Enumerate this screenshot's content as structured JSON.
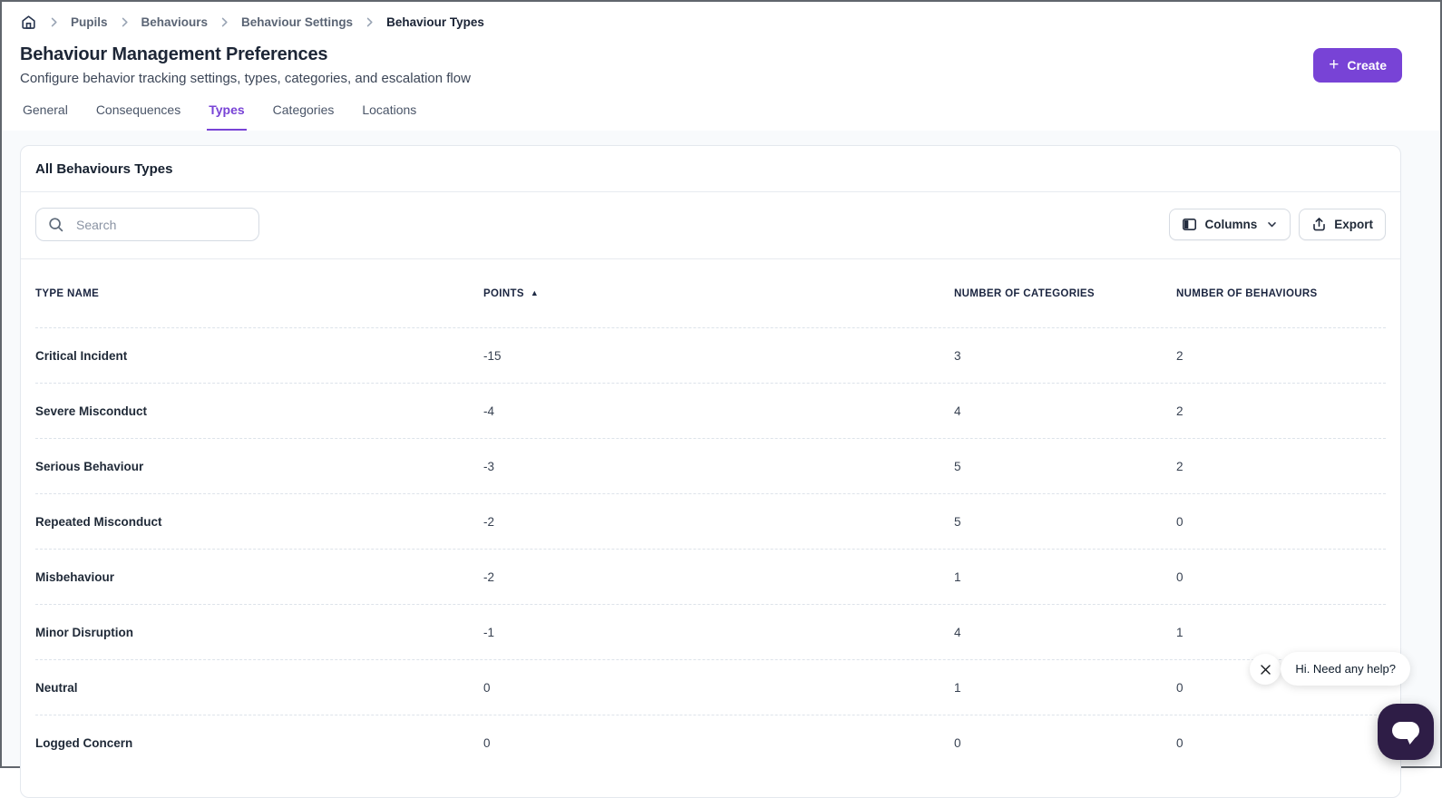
{
  "breadcrumb": {
    "items": [
      "Pupils",
      "Behaviours",
      "Behaviour Settings"
    ],
    "current": "Behaviour Types"
  },
  "header": {
    "title": "Behaviour Management Preferences",
    "subtitle": "Configure behavior tracking settings, types, categories, and escalation flow",
    "create_label": "Create"
  },
  "tabs": [
    {
      "label": "General",
      "active": false
    },
    {
      "label": "Consequences",
      "active": false
    },
    {
      "label": "Types",
      "active": true
    },
    {
      "label": "Categories",
      "active": false
    },
    {
      "label": "Locations",
      "active": false
    }
  ],
  "card": {
    "title": "All Behaviours Types",
    "search_placeholder": "Search",
    "columns_label": "Columns",
    "export_label": "Export"
  },
  "table": {
    "columns": [
      "TYPE NAME",
      "POINTS",
      "NUMBER OF CATEGORIES",
      "NUMBER OF BEHAVIOURS"
    ],
    "sort": {
      "column": "POINTS",
      "direction": "asc"
    },
    "rows": [
      {
        "type_name": "Critical Incident",
        "points": "-15",
        "categories": "3",
        "behaviours": "2"
      },
      {
        "type_name": "Severe Misconduct",
        "points": "-4",
        "categories": "4",
        "behaviours": "2"
      },
      {
        "type_name": "Serious Behaviour",
        "points": "-3",
        "categories": "5",
        "behaviours": "2"
      },
      {
        "type_name": "Repeated Misconduct",
        "points": "-2",
        "categories": "5",
        "behaviours": "0"
      },
      {
        "type_name": "Misbehaviour",
        "points": "-2",
        "categories": "1",
        "behaviours": "0"
      },
      {
        "type_name": "Minor Disruption",
        "points": "-1",
        "categories": "4",
        "behaviours": "1"
      },
      {
        "type_name": "Neutral",
        "points": "0",
        "categories": "1",
        "behaviours": "0"
      },
      {
        "type_name": "Logged Concern",
        "points": "0",
        "categories": "0",
        "behaviours": "0"
      }
    ]
  },
  "chat": {
    "message": "Hi. Need any help?"
  },
  "icons": {
    "home": "house-outline",
    "breadcrumb_separator": "chevron-right",
    "plus": "+",
    "search": "magnifier",
    "columns": "table-columns",
    "columns_chevron": "chevron-down",
    "export": "arrow-up-from-tray",
    "sort_asc": "▲",
    "chat_close": "x-mark",
    "chat_launcher": "speech-bubble"
  },
  "colors": {
    "accent": "#7843d6",
    "chat_launcher": "#2e1d46",
    "page_background": "#f8fafc"
  }
}
